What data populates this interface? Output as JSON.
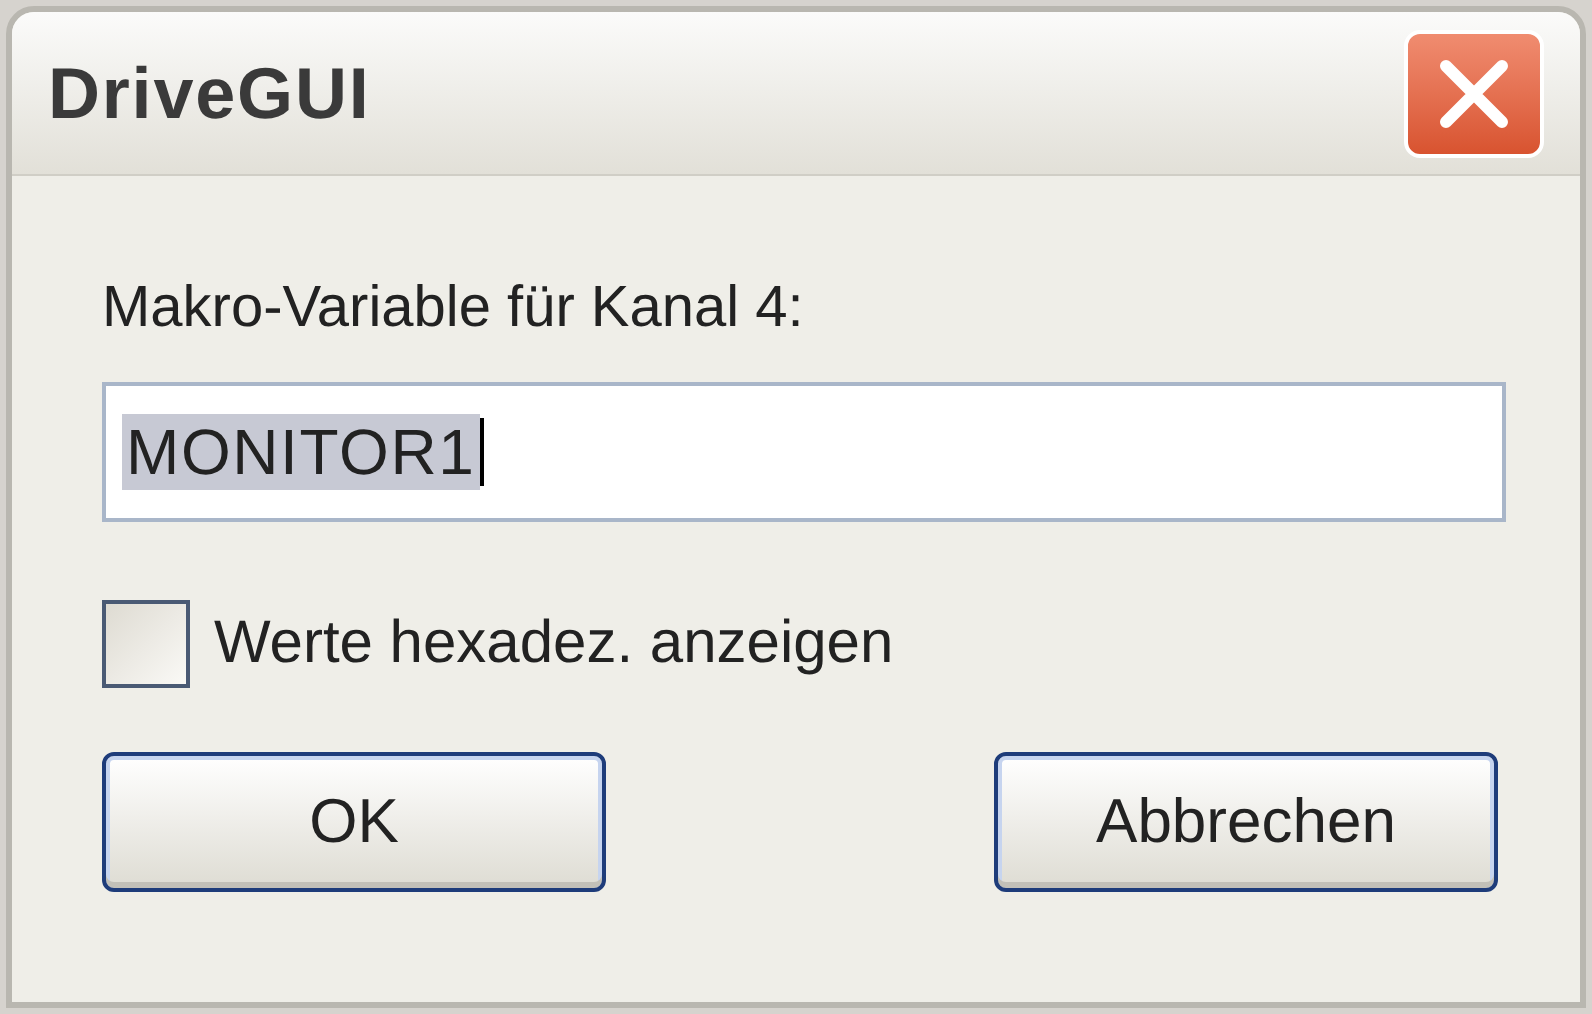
{
  "window": {
    "title": "DriveGUI"
  },
  "label": "Makro-Variable für Kanal 4:",
  "input": {
    "value": "MONITOR1",
    "text_selected": true
  },
  "checkbox": {
    "label": "Werte hexadez. anzeigen",
    "checked": false
  },
  "buttons": [
    {
      "label": "OK"
    },
    {
      "label": "Abbrechen"
    }
  ]
}
